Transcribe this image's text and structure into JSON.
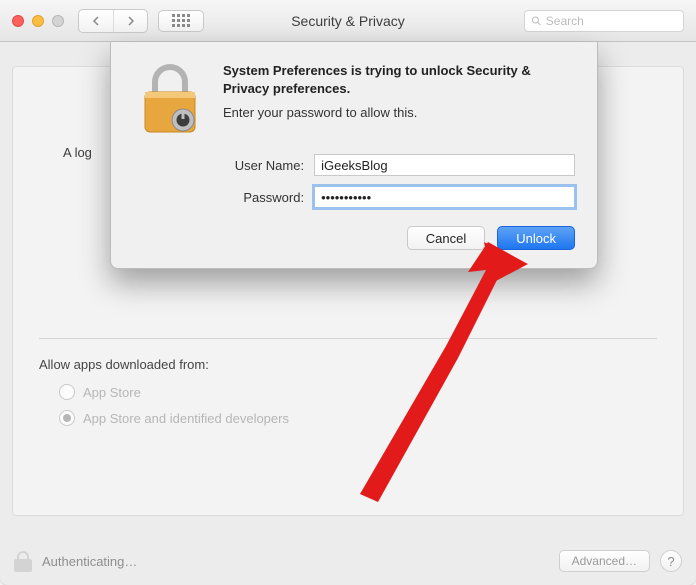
{
  "window": {
    "title": "Security & Privacy",
    "search_placeholder": "Search"
  },
  "pane": {
    "login_text": "A log",
    "allow_label": "Allow apps downloaded from:",
    "radio1": "App Store",
    "radio2": "App Store and identified developers"
  },
  "footer": {
    "status": "Authenticating…",
    "advanced": "Advanced…",
    "help": "?"
  },
  "dialog": {
    "bold": "System Preferences is trying to unlock Security & Privacy preferences.",
    "sub": "Enter your password to allow this.",
    "username_label": "User Name:",
    "password_label": "Password:",
    "username_value": "iGeeksBlog",
    "password_value": "•••••••••••",
    "cancel": "Cancel",
    "unlock": "Unlock"
  }
}
